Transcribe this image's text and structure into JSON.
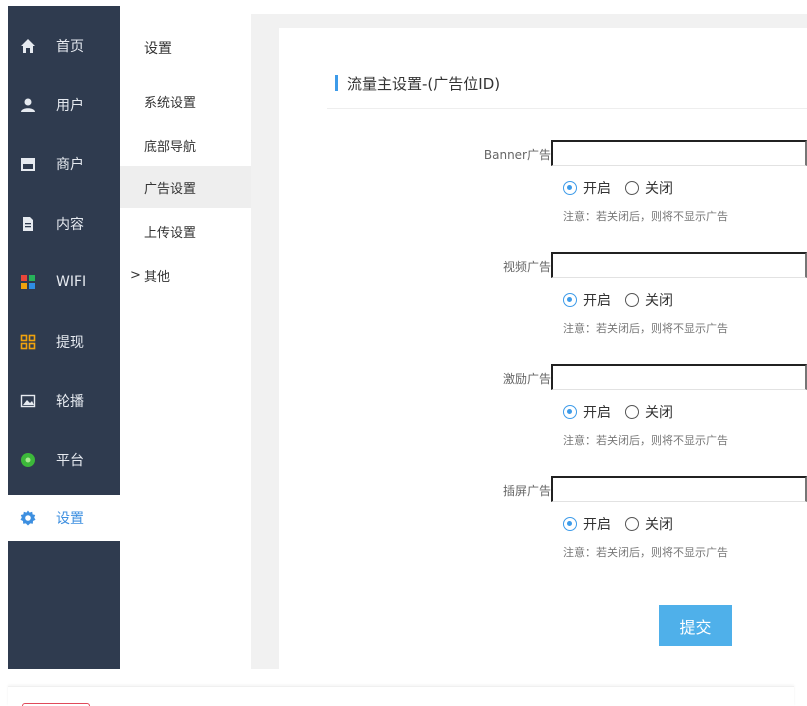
{
  "sidebar": {
    "items": [
      {
        "label": "首页",
        "icon": "home-icon"
      },
      {
        "label": "用户",
        "icon": "user-icon"
      },
      {
        "label": "商户",
        "icon": "store-icon"
      },
      {
        "label": "内容",
        "icon": "document-icon"
      },
      {
        "label": "WIFI",
        "icon": "wifi-app-icon"
      },
      {
        "label": "提现",
        "icon": "grid-icon"
      },
      {
        "label": "轮播",
        "icon": "image-icon"
      },
      {
        "label": "平台",
        "icon": "platform-icon"
      },
      {
        "label": "设置",
        "icon": "gear-icon",
        "active": true
      }
    ]
  },
  "submenu": {
    "title": "设置",
    "items": [
      {
        "label": "系统设置"
      },
      {
        "label": "底部导航"
      },
      {
        "label": "广告设置",
        "active": true
      },
      {
        "label": "上传设置"
      },
      {
        "label": "其他",
        "arrow": ">"
      }
    ]
  },
  "panel": {
    "title": "流量主设置-(广告位ID)"
  },
  "ads": [
    {
      "label": "Banner广告",
      "input_value": "",
      "on_label": "开启",
      "off_label": "关闭",
      "selected": "on",
      "note": "注意：若关闭后，则将不显示广告"
    },
    {
      "label": "视频广告",
      "input_value": "",
      "on_label": "开启",
      "off_label": "关闭",
      "selected": "on",
      "note": "注意：若关闭后，则将不显示广告"
    },
    {
      "label": "激励广告",
      "input_value": "",
      "on_label": "开启",
      "off_label": "关闭",
      "selected": "on",
      "note": "注意：若关闭后，则将不显示广告"
    },
    {
      "label": "插屏广告",
      "input_value": "",
      "on_label": "开启",
      "off_label": "关闭",
      "selected": "on",
      "note": "注意：若关闭后，则将不显示广告"
    }
  ],
  "submit_label": "提交",
  "colors": {
    "sidebar_bg": "#2f3b4f",
    "accent": "#3d9be9",
    "button": "#4fb0ea"
  }
}
